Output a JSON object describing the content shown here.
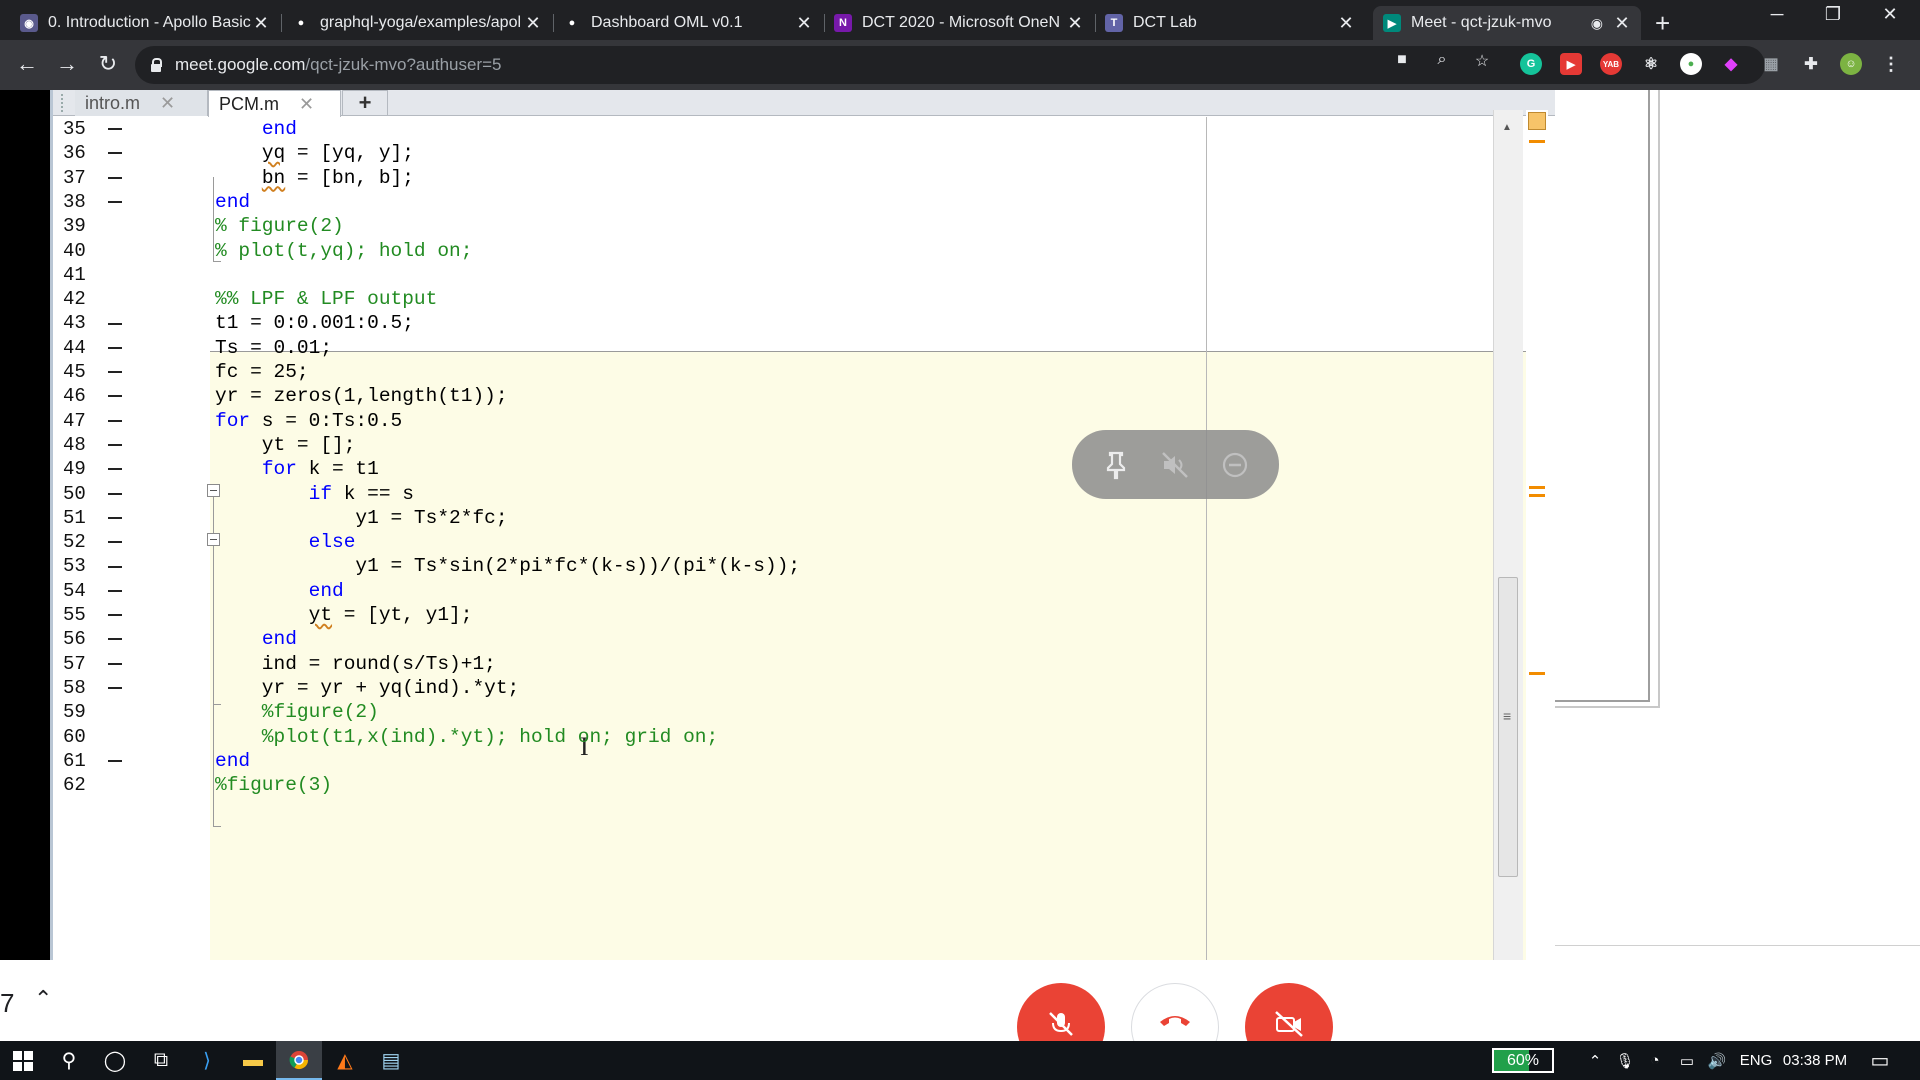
{
  "browser": {
    "tabs": [
      {
        "title": "0. Introduction - Apollo Basic",
        "favicon": "apollo-icon",
        "active": false
      },
      {
        "title": "graphql-yoga/examples/apol",
        "favicon": "github-icon",
        "active": false
      },
      {
        "title": "Dashboard OML v0.1",
        "favicon": "github-icon",
        "active": false
      },
      {
        "title": "DCT 2020 - Microsoft OneN",
        "favicon": "onenote-icon",
        "active": false
      },
      {
        "title": "DCT Lab",
        "favicon": "teams-icon",
        "active": false
      },
      {
        "title": "Meet - qct-jzuk-mvo",
        "favicon": "meet-icon",
        "active": true
      }
    ],
    "url_host": "meet.google.com",
    "url_path": "/qct-jzuk-mvo?authuser=5",
    "accent": "#35363a"
  },
  "editor": {
    "files": [
      {
        "name": "intro.m",
        "active": false
      },
      {
        "name": "PCM.m",
        "active": true
      }
    ],
    "new_tab_symbol": "+",
    "lines": [
      {
        "n": "35",
        "dash": true,
        "tokens": [
          {
            "t": "    ",
            "c": ""
          },
          {
            "t": "end",
            "c": "kw"
          }
        ]
      },
      {
        "n": "36",
        "dash": true,
        "tokens": [
          {
            "t": "    ",
            "c": ""
          },
          {
            "t": "yq",
            "c": "sq"
          },
          {
            "t": " = [yq, y];",
            "c": ""
          }
        ]
      },
      {
        "n": "37",
        "dash": true,
        "tokens": [
          {
            "t": "    ",
            "c": ""
          },
          {
            "t": "bn",
            "c": "sq"
          },
          {
            "t": " = [bn, b];",
            "c": ""
          }
        ]
      },
      {
        "n": "38",
        "dash": true,
        "tokens": [
          {
            "t": "end",
            "c": "kw"
          }
        ]
      },
      {
        "n": "39",
        "dash": false,
        "tokens": [
          {
            "t": "% figure(2)",
            "c": "cm"
          }
        ]
      },
      {
        "n": "40",
        "dash": false,
        "tokens": [
          {
            "t": "% plot(t,yq); hold on;",
            "c": "cm"
          }
        ]
      },
      {
        "n": "41",
        "dash": false,
        "tokens": [
          {
            "t": "",
            "c": ""
          }
        ]
      },
      {
        "n": "42",
        "dash": false,
        "tokens": [
          {
            "t": "%% LPF & LPF output",
            "c": "cm"
          }
        ]
      },
      {
        "n": "43",
        "dash": true,
        "tokens": [
          {
            "t": "t1 = 0:0.001:0.5;",
            "c": ""
          }
        ]
      },
      {
        "n": "44",
        "dash": true,
        "tokens": [
          {
            "t": "Ts = 0.01;",
            "c": ""
          }
        ]
      },
      {
        "n": "45",
        "dash": true,
        "tokens": [
          {
            "t": "fc = 25;",
            "c": ""
          }
        ]
      },
      {
        "n": "46",
        "dash": true,
        "tokens": [
          {
            "t": "yr = zeros(1,length(t1));",
            "c": ""
          }
        ]
      },
      {
        "n": "47",
        "dash": true,
        "tokens": [
          {
            "t": "for",
            "c": "kw"
          },
          {
            "t": " s = 0:Ts:0.5",
            "c": ""
          }
        ]
      },
      {
        "n": "48",
        "dash": true,
        "tokens": [
          {
            "t": "    yt = [];",
            "c": ""
          }
        ]
      },
      {
        "n": "49",
        "dash": true,
        "tokens": [
          {
            "t": "    ",
            "c": ""
          },
          {
            "t": "for",
            "c": "kw"
          },
          {
            "t": " k = t1",
            "c": ""
          }
        ]
      },
      {
        "n": "50",
        "dash": true,
        "tokens": [
          {
            "t": "        ",
            "c": ""
          },
          {
            "t": "if",
            "c": "kw"
          },
          {
            "t": " k == s",
            "c": ""
          }
        ]
      },
      {
        "n": "51",
        "dash": true,
        "tokens": [
          {
            "t": "            y1 = Ts*2*fc;",
            "c": ""
          }
        ]
      },
      {
        "n": "52",
        "dash": true,
        "tokens": [
          {
            "t": "        ",
            "c": ""
          },
          {
            "t": "else",
            "c": "kw"
          }
        ]
      },
      {
        "n": "53",
        "dash": true,
        "tokens": [
          {
            "t": "            y1 = Ts*sin(2*pi*fc*(k-s))/(pi*(k-s));",
            "c": ""
          }
        ]
      },
      {
        "n": "54",
        "dash": true,
        "tokens": [
          {
            "t": "        ",
            "c": ""
          },
          {
            "t": "end",
            "c": "kw"
          }
        ]
      },
      {
        "n": "55",
        "dash": true,
        "tokens": [
          {
            "t": "        ",
            "c": ""
          },
          {
            "t": "yt",
            "c": "sq"
          },
          {
            "t": " = [yt, y1];",
            "c": ""
          }
        ]
      },
      {
        "n": "56",
        "dash": true,
        "tokens": [
          {
            "t": "    ",
            "c": ""
          },
          {
            "t": "end",
            "c": "kw"
          }
        ]
      },
      {
        "n": "57",
        "dash": true,
        "tokens": [
          {
            "t": "    ind = round(s/Ts)+1;",
            "c": ""
          }
        ]
      },
      {
        "n": "58",
        "dash": true,
        "tokens": [
          {
            "t": "    yr = yr + yq(ind).*yt;",
            "c": ""
          }
        ]
      },
      {
        "n": "59",
        "dash": false,
        "tokens": [
          {
            "t": "    %figure(2)",
            "c": "cm"
          }
        ]
      },
      {
        "n": "60",
        "dash": false,
        "tokens": [
          {
            "t": "    %plot(t1,x(ind).*yt); hold on; grid on;",
            "c": "cm"
          }
        ]
      },
      {
        "n": "61",
        "dash": true,
        "tokens": [
          {
            "t": "end",
            "c": "kw"
          }
        ]
      },
      {
        "n": "62",
        "dash": false,
        "tokens": [
          {
            "t": "%figure(3)",
            "c": "cm"
          }
        ]
      }
    ]
  },
  "meet": {
    "participant_count": "7",
    "overlay_icons": [
      "pin-icon",
      "mute-audio-icon",
      "remove-icon"
    ]
  },
  "taskbar": {
    "battery": "60%",
    "language": "ENG",
    "time": "03:38 PM"
  }
}
